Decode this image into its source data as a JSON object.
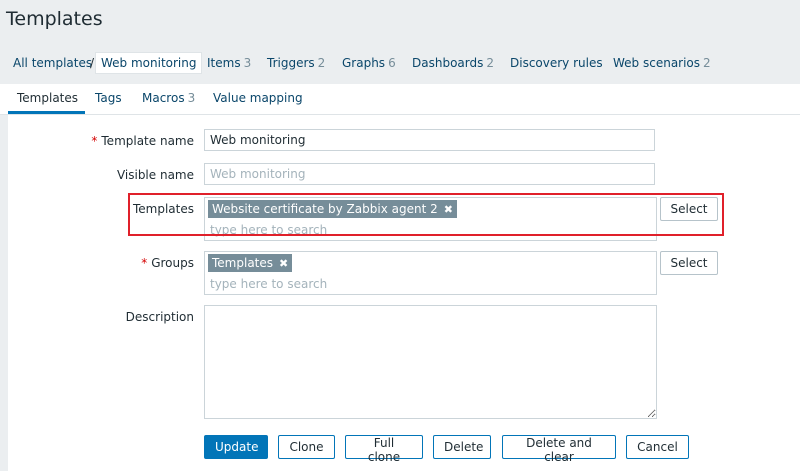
{
  "page": {
    "title": "Templates"
  },
  "nav": {
    "breadcrumb_root": "All templates",
    "breadcrumb_sep": "/",
    "breadcrumb_current": "Web monitoring",
    "items": [
      {
        "label": "Items",
        "count": "3"
      },
      {
        "label": "Triggers",
        "count": "2"
      },
      {
        "label": "Graphs",
        "count": "6"
      },
      {
        "label": "Dashboards",
        "count": "2"
      },
      {
        "label": "Discovery rules",
        "count": ""
      },
      {
        "label": "Web scenarios",
        "count": "2"
      }
    ]
  },
  "tabs": [
    {
      "label": "Templates",
      "count": "",
      "active": true
    },
    {
      "label": "Tags",
      "count": "",
      "active": false
    },
    {
      "label": "Macros",
      "count": "3",
      "active": false
    },
    {
      "label": "Value mapping",
      "count": "",
      "active": false
    }
  ],
  "form": {
    "required_mark": "*",
    "template_name": {
      "label": "Template name",
      "value": "Web monitoring",
      "required": true
    },
    "visible_name": {
      "label": "Visible name",
      "value": "",
      "placeholder": "Web monitoring"
    },
    "templates": {
      "label": "Templates",
      "chips": [
        "Website certificate by Zabbix agent 2"
      ],
      "search_placeholder": "type here to search",
      "select_label": "Select"
    },
    "groups": {
      "label": "Groups",
      "required": true,
      "chips": [
        "Templates"
      ],
      "search_placeholder": "type here to search",
      "select_label": "Select"
    },
    "description": {
      "label": "Description",
      "value": ""
    },
    "chip_remove_icon": "close-icon",
    "buttons": {
      "update": "Update",
      "clone": "Clone",
      "full_clone": "Full clone",
      "delete": "Delete",
      "delete_and_clear": "Delete and clear",
      "cancel": "Cancel"
    }
  },
  "colors": {
    "primary": "#0275b8",
    "link": "#0a466a",
    "required": "#d40000",
    "chip_bg": "#768d99",
    "highlight": "#e0202a"
  }
}
